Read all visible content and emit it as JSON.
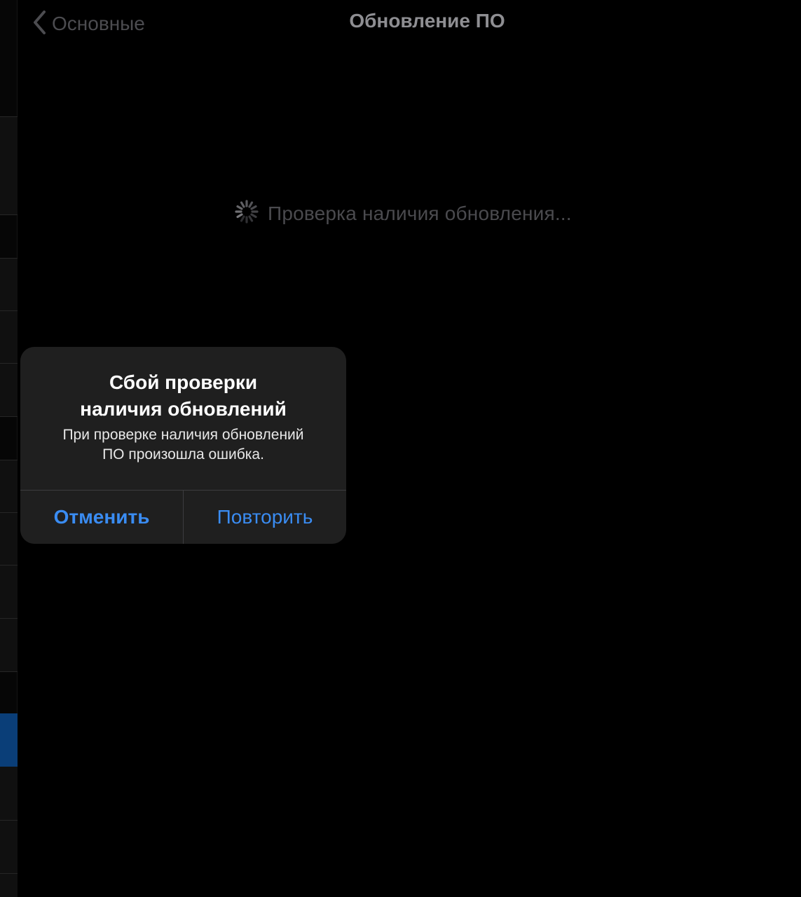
{
  "navbar": {
    "back_label": "Основные",
    "title": "Обновление ПО"
  },
  "status": {
    "text": "Проверка наличия обновления..."
  },
  "alert": {
    "title": "Сбой проверки\nналичия обновлений",
    "message": "При проверке наличия обновлений\nПО произошла ошибка.",
    "cancel_label": "Отменить",
    "retry_label": "Повторить"
  },
  "colors": {
    "background": "#000000",
    "alert_background": "#1f1f1f",
    "accent": "#3a8cf2",
    "sidebar_selected": "#0a3e78"
  },
  "icons": {
    "back": "chevron-left-icon",
    "activity": "activity-spinner-icon"
  }
}
